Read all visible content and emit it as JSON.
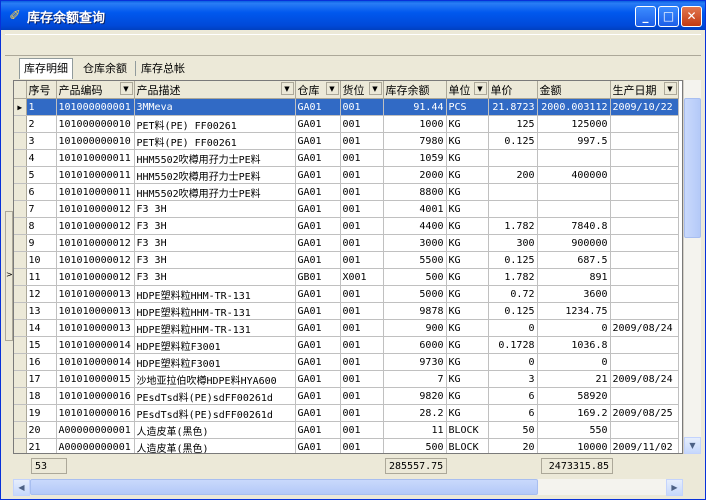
{
  "window": {
    "title": "库存余额查询",
    "minimize": "_",
    "maximize": "□",
    "close": "✕"
  },
  "tabs": [
    "库存明细",
    "仓库余额",
    "库存总帐"
  ],
  "columns": [
    {
      "label": "序号",
      "dropdown": false
    },
    {
      "label": "产品编码",
      "dropdown": true
    },
    {
      "label": "产品描述",
      "dropdown": true
    },
    {
      "label": "仓库",
      "dropdown": true
    },
    {
      "label": "货位",
      "dropdown": true
    },
    {
      "label": "库存余额",
      "dropdown": false
    },
    {
      "label": "单位",
      "dropdown": true
    },
    {
      "label": "单价",
      "dropdown": false
    },
    {
      "label": "金额",
      "dropdown": false
    },
    {
      "label": "生产日期",
      "dropdown": true
    }
  ],
  "rows": [
    [
      "1",
      "101000000001",
      "3MMeva",
      "GA01",
      "001",
      "91.44",
      "PCS",
      "21.8723",
      "2000.003112",
      "2009/10/22"
    ],
    [
      "2",
      "101000000010",
      "PET料(PE) FF00261",
      "GA01",
      "001",
      "1000",
      "KG",
      "125",
      "125000",
      ""
    ],
    [
      "3",
      "101000000010",
      "PET料(PE) FF00261",
      "GA01",
      "001",
      "7980",
      "KG",
      "0.125",
      "997.5",
      ""
    ],
    [
      "4",
      "101010000011",
      "HHM5502吹樽用孖力士PE料",
      "GA01",
      "001",
      "1059",
      "KG",
      "",
      "",
      ""
    ],
    [
      "5",
      "101010000011",
      "HHM5502吹樽用孖力士PE料",
      "GA01",
      "001",
      "2000",
      "KG",
      "200",
      "400000",
      ""
    ],
    [
      "6",
      "101010000011",
      "HHM5502吹樽用孖力士PE料",
      "GA01",
      "001",
      "8800",
      "KG",
      "",
      "",
      ""
    ],
    [
      "7",
      "101010000012",
      "F3 3H",
      "GA01",
      "001",
      "4001",
      "KG",
      "",
      "",
      ""
    ],
    [
      "8",
      "101010000012",
      "F3 3H",
      "GA01",
      "001",
      "4400",
      "KG",
      "1.782",
      "7840.8",
      ""
    ],
    [
      "9",
      "101010000012",
      "F3 3H",
      "GA01",
      "001",
      "3000",
      "KG",
      "300",
      "900000",
      ""
    ],
    [
      "10",
      "101010000012",
      "F3 3H",
      "GA01",
      "001",
      "5500",
      "KG",
      "0.125",
      "687.5",
      ""
    ],
    [
      "11",
      "101010000012",
      "F3 3H",
      "GB01",
      "X001",
      "500",
      "KG",
      "1.782",
      "891",
      ""
    ],
    [
      "12",
      "101010000013",
      "HDPE塑料粒HHM-TR-131",
      "GA01",
      "001",
      "5000",
      "KG",
      "0.72",
      "3600",
      ""
    ],
    [
      "13",
      "101010000013",
      "HDPE塑料粒HHM-TR-131",
      "GA01",
      "001",
      "9878",
      "KG",
      "0.125",
      "1234.75",
      ""
    ],
    [
      "14",
      "101010000013",
      "HDPE塑料粒HHM-TR-131",
      "GA01",
      "001",
      "900",
      "KG",
      "0",
      "0",
      "2009/08/24"
    ],
    [
      "15",
      "101010000014",
      "HDPE塑料粒F3001",
      "GA01",
      "001",
      "6000",
      "KG",
      "0.1728",
      "1036.8",
      ""
    ],
    [
      "16",
      "101010000014",
      "HDPE塑料粒F3001",
      "GA01",
      "001",
      "9730",
      "KG",
      "0",
      "0",
      ""
    ],
    [
      "17",
      "101010000015",
      "沙地亚拉伯吹樽HDPE料HYA600",
      "GA01",
      "001",
      "7",
      "KG",
      "3",
      "21",
      "2009/08/24"
    ],
    [
      "18",
      "101010000016",
      "PEsdTsd料(PE)sdFF00261d",
      "GA01",
      "001",
      "9820",
      "KG",
      "6",
      "58920",
      ""
    ],
    [
      "19",
      "101010000016",
      "PEsdTsd料(PE)sdFF00261d",
      "GA01",
      "001",
      "28.2",
      "KG",
      "6",
      "169.2",
      "2009/08/25"
    ],
    [
      "20",
      "A00000000001",
      "人造皮革(黑色)",
      "GA01",
      "001",
      "11",
      "BLOCK",
      "50",
      "550",
      ""
    ],
    [
      "21",
      "A00000000001",
      "人造皮革(黑色)",
      "GA01",
      "001",
      "500",
      "BLOCK",
      "20",
      "10000",
      "2009/11/02"
    ]
  ],
  "footer": {
    "count": "53",
    "total_balance": "285557.75",
    "total_amount": "2473315.85"
  }
}
